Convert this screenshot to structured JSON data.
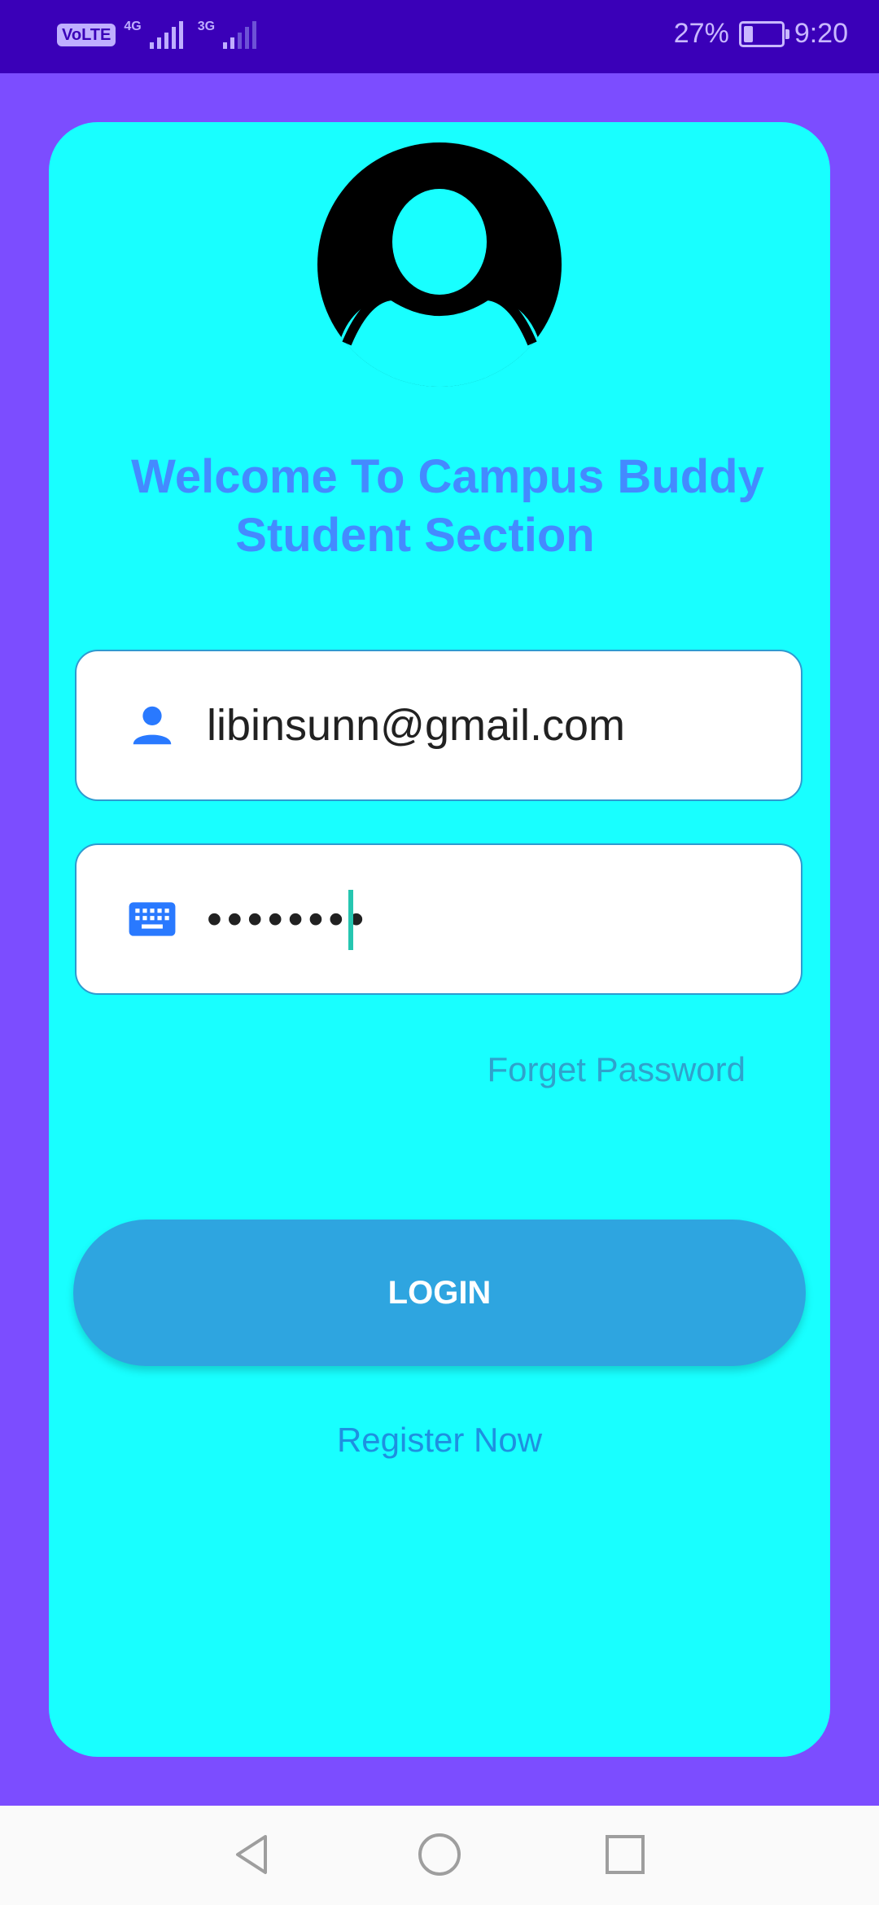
{
  "status_bar": {
    "volte": "VoLTE",
    "sim1_net": "4G",
    "sim2_net": "3G",
    "battery": "27%",
    "time": "9:20",
    "battery_level": 0.27
  },
  "header": {
    "avatar_icon": "account-circle-icon",
    "welcome_line1": "Welcome To Campus Buddy",
    "welcome_line2": "Student Section"
  },
  "form": {
    "email": {
      "icon": "person-icon",
      "value": "libinsunn@gmail.com"
    },
    "password": {
      "icon": "keyboard-icon",
      "value": "••••••••"
    },
    "forget_label": "Forget Password",
    "login_label": "LOGIN",
    "register_label": "Register Now"
  },
  "nav": {
    "back": "back-icon",
    "home": "home-icon",
    "recents": "recents-icon"
  },
  "colors": {
    "background": "#7c4dff",
    "status_bar": "#3a00b8",
    "card": "#18ffff",
    "accent": "#448aff",
    "button": "#2ea5e0"
  }
}
